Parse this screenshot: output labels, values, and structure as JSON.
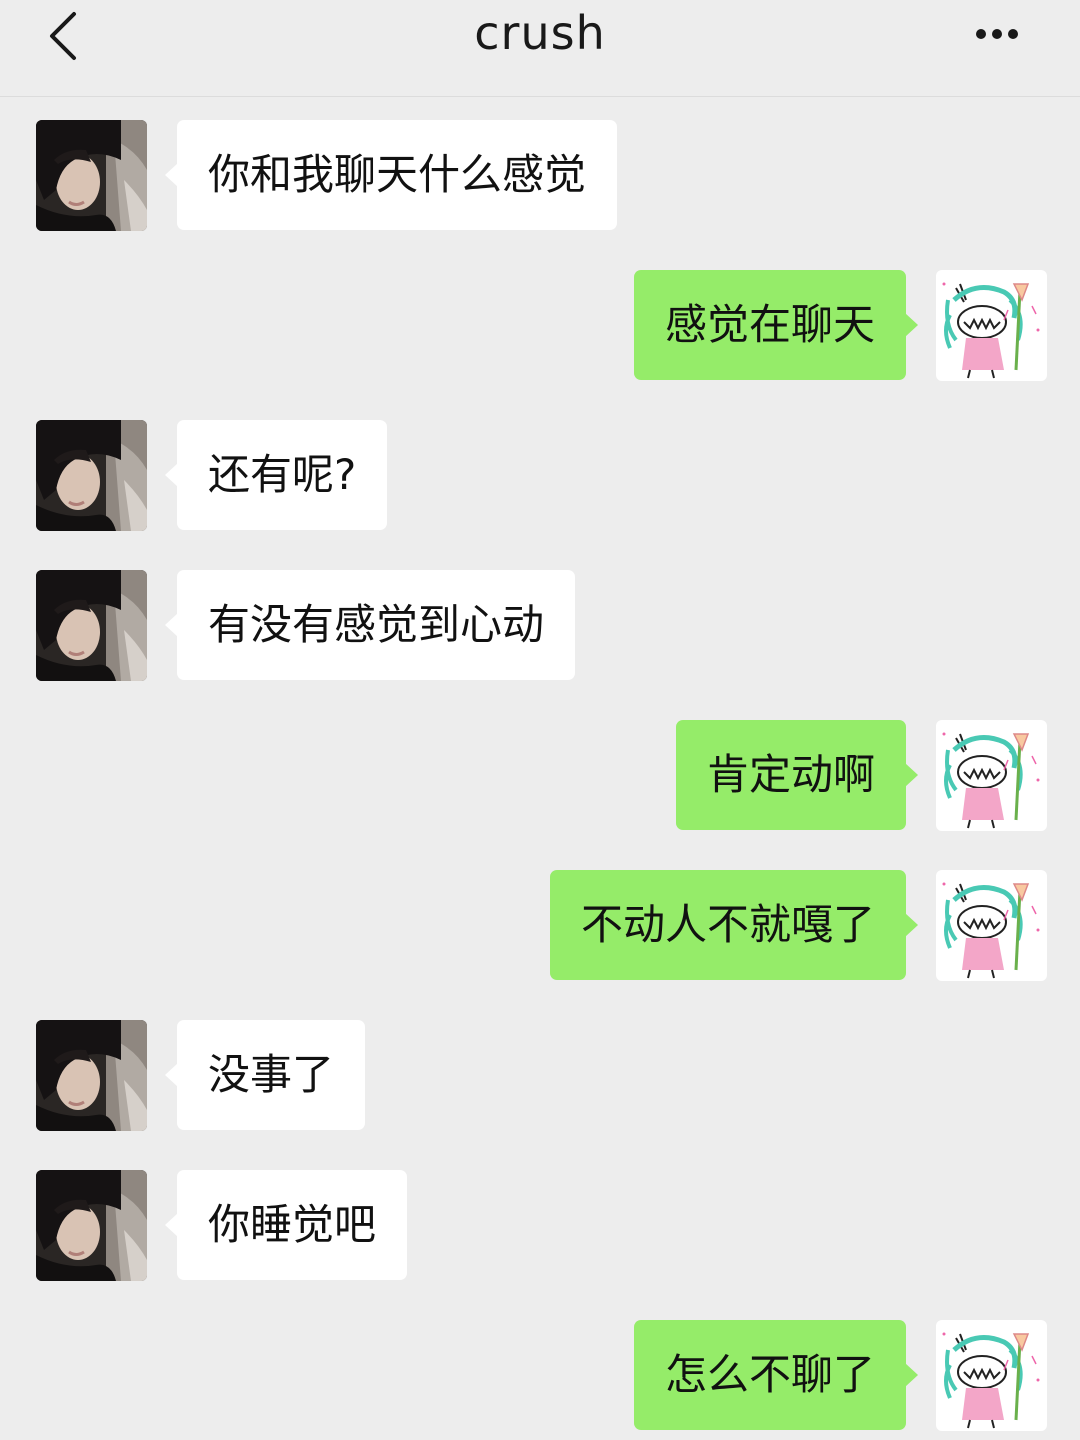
{
  "header": {
    "title": "crush",
    "back_icon": "chevron-left-icon",
    "more_icon": "more-dots-icon"
  },
  "colors": {
    "background": "#ededed",
    "incoming_bubble": "#ffffff",
    "outgoing_bubble": "#95ec69",
    "text": "#111111"
  },
  "messages": [
    {
      "direction": "incoming",
      "text": "你和我聊天什么感觉"
    },
    {
      "direction": "outgoing",
      "text": "感觉在聊天"
    },
    {
      "direction": "incoming",
      "text": "还有呢?"
    },
    {
      "direction": "incoming",
      "text": "有没有感觉到心动"
    },
    {
      "direction": "outgoing",
      "text": "肯定动啊"
    },
    {
      "direction": "outgoing",
      "text": "不动人不就嘎了"
    },
    {
      "direction": "incoming",
      "text": "没事了"
    },
    {
      "direction": "incoming",
      "text": "你睡觉吧"
    },
    {
      "direction": "outgoing",
      "text": "怎么不聊了"
    }
  ]
}
